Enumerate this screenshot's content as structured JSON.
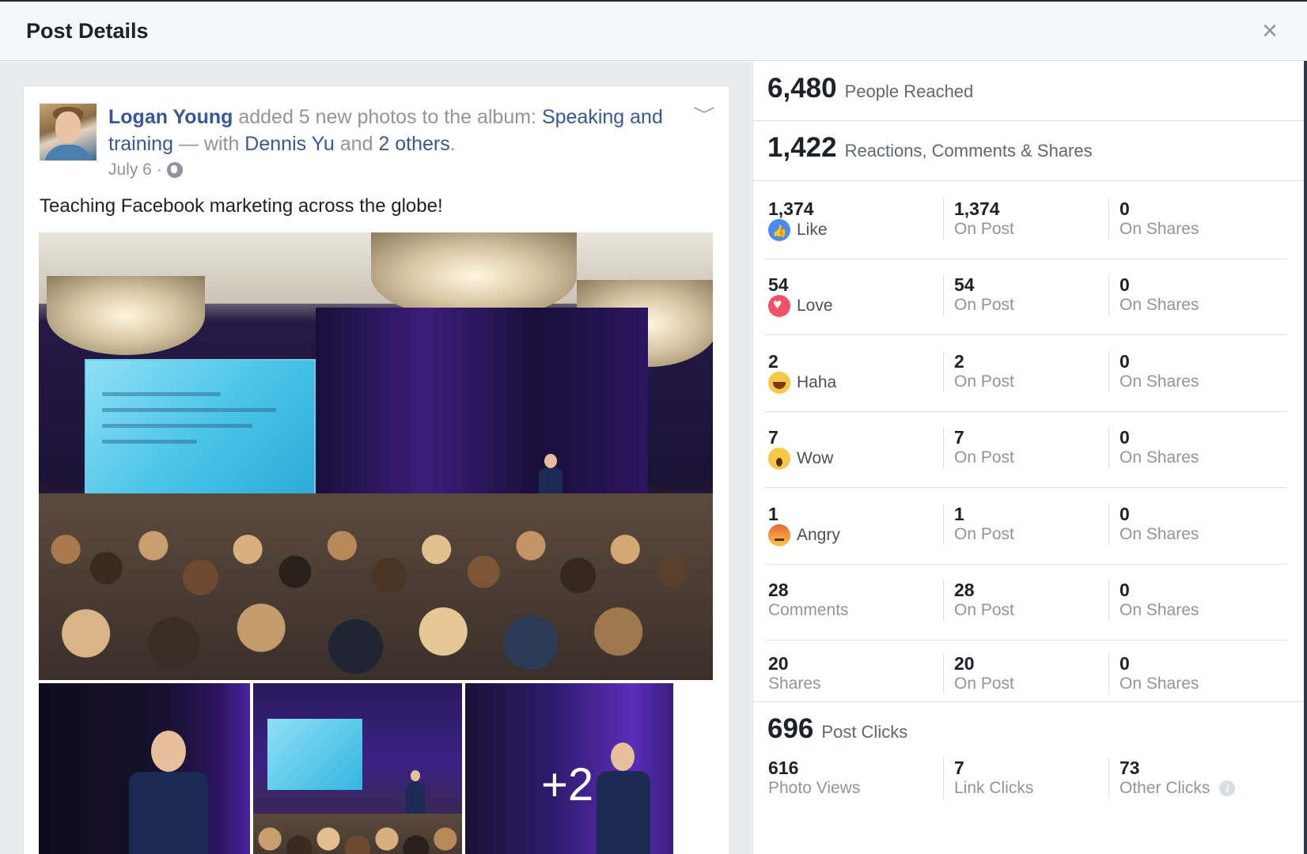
{
  "dialog": {
    "title": "Post Details",
    "close_label": "×"
  },
  "post": {
    "author": "Logan Young",
    "action_text": " added 5 new photos to the album: ",
    "album_name": "Speaking and training",
    "with_text": " — with ",
    "tagged_name": "Dennis Yu",
    "and_text": " and ",
    "others_link": "2 others",
    "period": ".",
    "date": "July 6 ·",
    "body_text": "Teaching Facebook marketing across the globe!",
    "more_photos_label": "+2",
    "chevron": "﹀"
  },
  "insights": {
    "reach": {
      "value": "6,480",
      "label": "People Reached"
    },
    "engagement": {
      "value": "1,422",
      "label": "Reactions, Comments & Shares"
    },
    "rows": [
      {
        "total": "1,374",
        "label": "Like",
        "icon": "like-reaction-icon",
        "on_post": "1,374",
        "on_post_label": "On Post",
        "on_shares": "0",
        "on_shares_label": "On Shares"
      },
      {
        "total": "54",
        "label": "Love",
        "icon": "love-reaction-icon",
        "on_post": "54",
        "on_post_label": "On Post",
        "on_shares": "0",
        "on_shares_label": "On Shares"
      },
      {
        "total": "2",
        "label": "Haha",
        "icon": "haha-reaction-icon",
        "on_post": "2",
        "on_post_label": "On Post",
        "on_shares": "0",
        "on_shares_label": "On Shares"
      },
      {
        "total": "7",
        "label": "Wow",
        "icon": "wow-reaction-icon",
        "on_post": "7",
        "on_post_label": "On Post",
        "on_shares": "0",
        "on_shares_label": "On Shares"
      },
      {
        "total": "1",
        "label": "Angry",
        "icon": "angry-reaction-icon",
        "on_post": "1",
        "on_post_label": "On Post",
        "on_shares": "0",
        "on_shares_label": "On Shares"
      },
      {
        "total": "28",
        "label": "Comments",
        "on_post": "28",
        "on_post_label": "On Post",
        "on_shares": "0",
        "on_shares_label": "On Shares"
      },
      {
        "total": "20",
        "label": "Shares",
        "on_post": "20",
        "on_post_label": "On Post",
        "on_shares": "0",
        "on_shares_label": "On Shares"
      }
    ],
    "clicks": {
      "value": "696",
      "label": "Post Clicks",
      "photo_views": "616",
      "photo_views_label": "Photo Views",
      "link_clicks": "7",
      "link_clicks_label": "Link Clicks",
      "other_clicks": "73",
      "other_clicks_label": "Other Clicks",
      "info_glyph": "i"
    }
  },
  "colors": {
    "link": "#365899",
    "like": "#4a8af4",
    "love": "#f25268",
    "emoji_yellow": "#f7c843"
  }
}
